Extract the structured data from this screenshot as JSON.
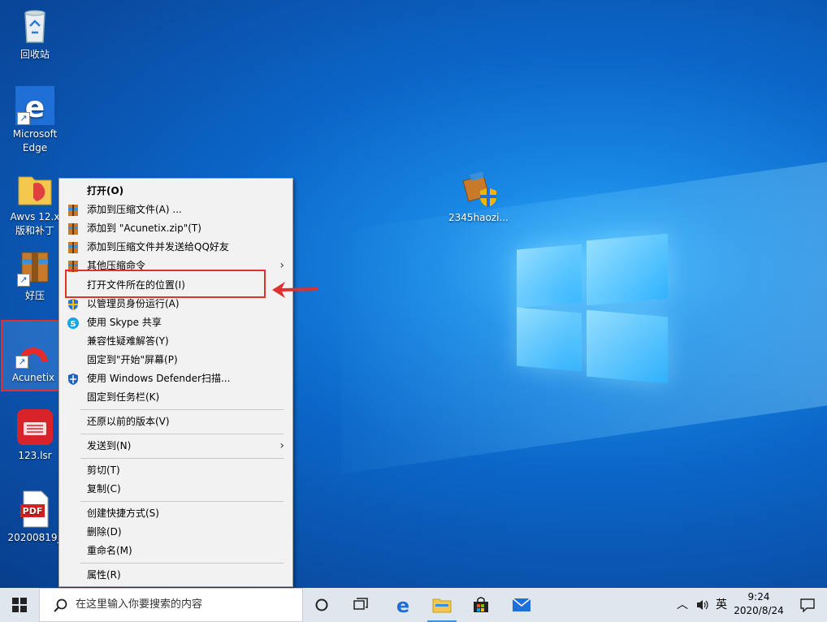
{
  "desktop": {
    "icons": [
      {
        "label": "回收站",
        "icon": "recycle-bin-icon"
      },
      {
        "label": "Microsoft Edge",
        "icon": "edge-icon"
      },
      {
        "label": "Awvs 12.x 版和补丁",
        "icon": "folder-icon"
      },
      {
        "label": "好压",
        "icon": "haozip-icon"
      },
      {
        "label": "Acunetix",
        "icon": "acunetix-icon"
      },
      {
        "label": "123.lsr",
        "icon": "lsr-file-icon"
      },
      {
        "label": "20200819_",
        "icon": "pdf-icon"
      },
      {
        "label": "2345haozi...",
        "icon": "installer-icon"
      }
    ]
  },
  "context_menu": {
    "items": [
      {
        "label": "打开(O)",
        "bold": true
      },
      {
        "label": "添加到压缩文件(A) ...",
        "icon": "archive-icon"
      },
      {
        "label": "添加到 \"Acunetix.zip\"(T)",
        "icon": "archive-icon"
      },
      {
        "label": "添加到压缩文件并发送给QQ好友",
        "icon": "archive-icon"
      },
      {
        "label": "其他压缩命令",
        "icon": "archive-icon",
        "submenu": true
      },
      {
        "label": "打开文件所在的位置(I)"
      },
      {
        "label": "以管理员身份运行(A)",
        "icon": "uac-shield-icon"
      },
      {
        "label": "使用 Skype 共享",
        "icon": "skype-icon"
      },
      {
        "label": "兼容性疑难解答(Y)"
      },
      {
        "label": "固定到\"开始\"屏幕(P)"
      },
      {
        "label": "使用 Windows Defender扫描...",
        "icon": "defender-icon"
      },
      {
        "label": "固定到任务栏(K)"
      },
      {
        "label": "还原以前的版本(V)"
      },
      {
        "label": "发送到(N)",
        "submenu": true
      },
      {
        "label": "剪切(T)"
      },
      {
        "label": "复制(C)"
      },
      {
        "label": "创建快捷方式(S)"
      },
      {
        "label": "删除(D)"
      },
      {
        "label": "重命名(M)"
      },
      {
        "label": "属性(R)"
      }
    ]
  },
  "taskbar": {
    "search_placeholder": "在这里输入你要搜索的内容",
    "ime": "英",
    "time": "9:24",
    "date": "2020/8/24"
  },
  "colors": {
    "accent": "#0b67c9",
    "highlight": "#e03030",
    "taskbar": "#dfe6ee"
  }
}
